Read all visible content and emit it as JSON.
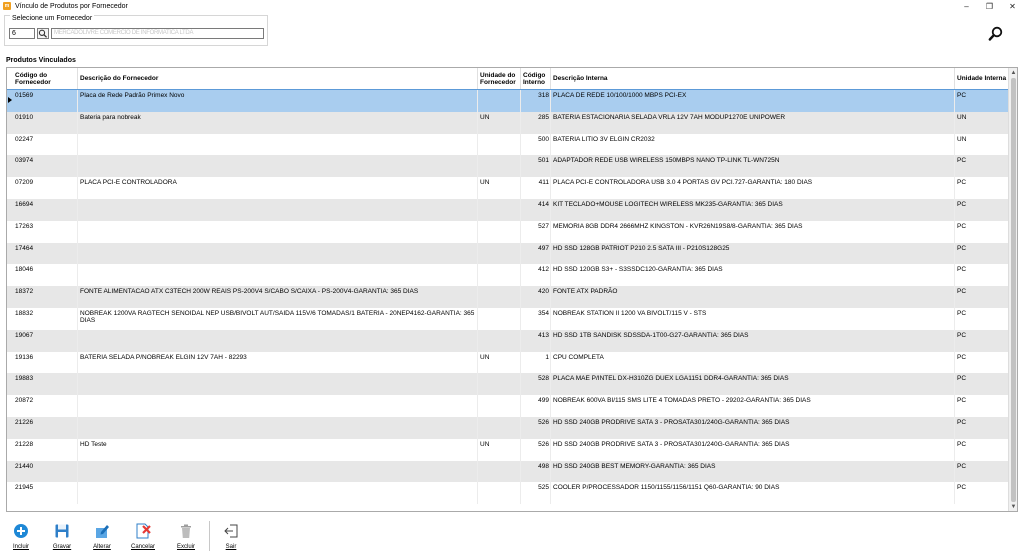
{
  "window": {
    "title": "Vínculo de Produtos por Fornecedor",
    "minimize": "–",
    "maximize": "❐",
    "close": "✕"
  },
  "supplier": {
    "group_label": "Selecione um Fornecedor",
    "code": "6",
    "name": "MERCADOLIVRE COMERCIO DE INFORMATICA LTDA"
  },
  "section_title": "Produtos Vinculados",
  "table": {
    "headers": {
      "cod_forn": "Código do Fornecedor",
      "desc_forn": "Descrição do Fornecedor",
      "unid_forn": "Unidade do Fornecedor",
      "cod_int": "Código Interno",
      "desc_int": "Descrição Interna",
      "unid_int": "Unidade Interna"
    },
    "rows": [
      {
        "cod_forn": "01569",
        "desc_forn": "Placa de Rede Padrão Primex Novo",
        "unid_forn": "",
        "cod_int": "318",
        "desc_int": "PLACA DE REDE 10/100/1000 MBPS PCI-EX",
        "unid_int": "PC"
      },
      {
        "cod_forn": "01910",
        "desc_forn": "Bateria para nobreak",
        "unid_forn": "UN",
        "cod_int": "285",
        "desc_int": "BATERIA ESTACIONARIA SELADA VRLA 12V 7AH MODUP1270E UNIPOWER",
        "unid_int": "UN"
      },
      {
        "cod_forn": "02247",
        "desc_forn": "",
        "unid_forn": "",
        "cod_int": "500",
        "desc_int": "BATERIA LITIO 3V ELGIN CR2032",
        "unid_int": "UN"
      },
      {
        "cod_forn": "03974",
        "desc_forn": "",
        "unid_forn": "",
        "cod_int": "501",
        "desc_int": "ADAPTADOR REDE USB WIRELESS 150MBPS NANO TP-LINK TL-WN725N",
        "unid_int": "PC"
      },
      {
        "cod_forn": "07209",
        "desc_forn": "PLACA PCI-E CONTROLADORA",
        "unid_forn": "UN",
        "cod_int": "411",
        "desc_int": "PLACA PCI-E CONTROLADORA USB 3.0 4 PORTAS GV PCI.727-GARANTIA: 180 DIAS",
        "unid_int": "PC"
      },
      {
        "cod_forn": "16694",
        "desc_forn": "",
        "unid_forn": "",
        "cod_int": "414",
        "desc_int": "KIT TECLADO+MOUSE LOGITECH WIRELESS MK235-GARANTIA: 365 DIAS",
        "unid_int": "PC"
      },
      {
        "cod_forn": "17263",
        "desc_forn": "",
        "unid_forn": "",
        "cod_int": "527",
        "desc_int": "MEMORIA 8GB DDR4 2666MHZ KINGSTON - KVR26N19S8/8-GARANTIA: 365 DIAS",
        "unid_int": "PC"
      },
      {
        "cod_forn": "17464",
        "desc_forn": "",
        "unid_forn": "",
        "cod_int": "497",
        "desc_int": "HD SSD 128GB PATRIOT P210 2.5 SATA III - P210S128G25",
        "unid_int": "PC"
      },
      {
        "cod_forn": "18046",
        "desc_forn": "",
        "unid_forn": "",
        "cod_int": "412",
        "desc_int": "HD SSD 120GB S3+ - S3SSDC120-GARANTIA: 365 DIAS",
        "unid_int": "PC"
      },
      {
        "cod_forn": "18372",
        "desc_forn": "FONTE ALIMENTACAO ATX C3TECH 200W REAIS PS-200V4 S/CABO S/CAIXA - PS-200V4-GARANTIA: 365 DIAS",
        "unid_forn": "",
        "cod_int": "420",
        "desc_int": "FONTE ATX PADRÃO",
        "unid_int": "PC"
      },
      {
        "cod_forn": "18832",
        "desc_forn": "NOBREAK 1200VA RAGTECH SENOIDAL NEP USB/BIVOLT AUT/SAIDA 115V/6 TOMADAS/1 BATERIA - 20NEP4162-GARANTIA: 365 DIAS",
        "unid_forn": "",
        "cod_int": "354",
        "desc_int": "NOBREAK STATION II 1200 VA BIVOLT/115 V - STS",
        "unid_int": "PC"
      },
      {
        "cod_forn": "19067",
        "desc_forn": "",
        "unid_forn": "",
        "cod_int": "413",
        "desc_int": "HD SSD 1TB SANDISK SDSSDA-1T00-G27-GARANTIA: 365 DIAS",
        "unid_int": "PC"
      },
      {
        "cod_forn": "19136",
        "desc_forn": "BATERIA SELADA P/NOBREAK ELGIN 12V 7AH - 82293",
        "unid_forn": "UN",
        "cod_int": "1",
        "desc_int": "CPU COMPLETA",
        "unid_int": "PC"
      },
      {
        "cod_forn": "19883",
        "desc_forn": "",
        "unid_forn": "",
        "cod_int": "528",
        "desc_int": "PLACA MAE P/INTEL DX-H310ZG DUEX LGA1151 DDR4-GARANTIA: 365 DIAS",
        "unid_int": "PC"
      },
      {
        "cod_forn": "20872",
        "desc_forn": "",
        "unid_forn": "",
        "cod_int": "499",
        "desc_int": "NOBREAK 600VA BI/115 SMS LITE 4 TOMADAS PRETO - 29202-GARANTIA: 365 DIAS",
        "unid_int": "PC"
      },
      {
        "cod_forn": "21226",
        "desc_forn": "",
        "unid_forn": "",
        "cod_int": "526",
        "desc_int": "HD SSD 240GB PRODRIVE SATA 3 - PROSATA301/240G-GARANTIA: 365 DIAS",
        "unid_int": "PC"
      },
      {
        "cod_forn": "21228",
        "desc_forn": "HD Teste",
        "unid_forn": "UN",
        "cod_int": "526",
        "desc_int": "HD SSD 240GB PRODRIVE SATA 3 - PROSATA301/240G-GARANTIA: 365 DIAS",
        "unid_int": "PC"
      },
      {
        "cod_forn": "21440",
        "desc_forn": "",
        "unid_forn": "",
        "cod_int": "498",
        "desc_int": "HD SSD 240GB BEST MEMORY-GARANTIA: 365 DIAS",
        "unid_int": "PC"
      },
      {
        "cod_forn": "21945",
        "desc_forn": "",
        "unid_forn": "",
        "cod_int": "525",
        "desc_int": "COOLER P/PROCESSADOR 1150/1155/1156/1151 Q60-GARANTIA: 90 DIAS",
        "unid_int": "PC"
      }
    ]
  },
  "toolbar": {
    "incluir": "Incluir",
    "gravar": "Gravar",
    "alterar": "Alterar",
    "cancelar": "Cancelar",
    "excluir": "Excluir",
    "sair": "Sair"
  },
  "colors": {
    "selected_row": "#a9cdef",
    "alt_row": "#e7e7e7",
    "accent_blue": "#1e88d6",
    "cancel_red": "#e53935"
  }
}
